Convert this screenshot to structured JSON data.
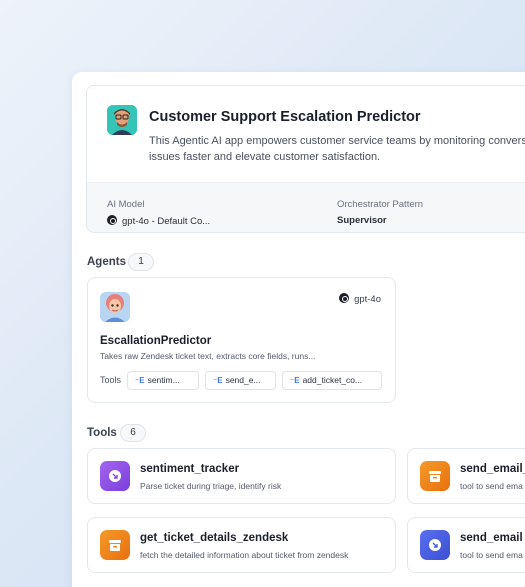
{
  "app": {
    "title": "Customer Support Escalation Predictor",
    "description": "This Agentic AI app empowers customer service teams by monitoring conversati issues faster and elevate customer satisfaction."
  },
  "meta": {
    "ai_model_label": "AI Model",
    "ai_model_value": "gpt-4o - Default Co...",
    "orchestrator_label": "Orchestrator Pattern",
    "orchestrator_value": "Supervisor"
  },
  "agents_section": {
    "label": "Agents",
    "count": "1"
  },
  "agent": {
    "name": "EscallationPredictor",
    "model": "gpt-4o",
    "description": "Takes raw Zendesk ticket text, extracts core fields, runs...",
    "tools_label": "Tools",
    "tool_chips": [
      "sentim...",
      "send_e...",
      "add_ticket_co..."
    ]
  },
  "tools_section": {
    "label": "Tools",
    "count": "6"
  },
  "tools": [
    {
      "name": "sentiment_tracker",
      "desc": "Parse ticket during triage, identify risk",
      "color": "#8b4fe6",
      "icon": "arrow-badge-icon"
    },
    {
      "name": "send_email_",
      "desc": "tool to send ema",
      "color": "#ee8419",
      "icon": "archive-icon"
    },
    {
      "name": "get_ticket_details_zendesk",
      "desc": "fetch the detailed information about ticket from zendesk",
      "color": "#ee8419",
      "icon": "archive-icon"
    },
    {
      "name": "send_email",
      "desc": "tool to send ema",
      "color": "#4a5fe0",
      "icon": "arrow-badge-icon"
    }
  ]
}
